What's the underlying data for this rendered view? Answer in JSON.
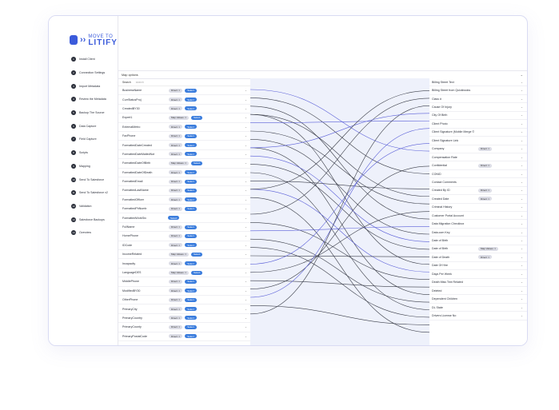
{
  "brand": {
    "line1": "MOVE TO",
    "line2": "LITIFY"
  },
  "steps": [
    {
      "num": "1",
      "label": "Install Client"
    },
    {
      "num": "2",
      "label": "Connection Settings"
    },
    {
      "num": "3",
      "label": "Import Metadata"
    },
    {
      "num": "4",
      "label": "Review the Metadata"
    },
    {
      "num": "5",
      "label": "Backup The Source"
    },
    {
      "num": "6",
      "label": "Data Capture"
    },
    {
      "num": "7",
      "label": "Field Capture"
    },
    {
      "num": "8",
      "label": "Scripts"
    },
    {
      "num": "9",
      "label": "Mapping"
    },
    {
      "num": "10",
      "label": "Send To Salesforce"
    },
    {
      "num": "11",
      "label": "Send To Salesforce v2"
    },
    {
      "num": "12",
      "label": "Validation"
    },
    {
      "num": "13",
      "label": "Salesforce Backups"
    },
    {
      "num": "14",
      "label": "Overview"
    }
  ],
  "map_options": {
    "label": "Map options",
    "caret": "⌄"
  },
  "search": {
    "label": "Search",
    "placeholder": "search"
  },
  "select_label": "Select",
  "left_fields": [
    {
      "name": "BusinessName",
      "chip": "Direct ⇒"
    },
    {
      "name": "CurrStatusProj",
      "chip": "Direct ⇒"
    },
    {
      "name": "CreatedBY30",
      "chip": "Direct ⇒"
    },
    {
      "name": "Expert1",
      "chip": "Map Values ⇒"
    },
    {
      "name": "ExternalMetro",
      "chip": "Direct ⇒"
    },
    {
      "name": "FaxPhone",
      "chip": "Direct ⇒"
    },
    {
      "name": "FormattedDateCreated",
      "chip": "Direct ⇒"
    },
    {
      "name": "FormattedDateMailedNot",
      "chip": "Direct ⇒"
    },
    {
      "name": "FormattedDateOfBirth",
      "chip": "Map Values ⇒"
    },
    {
      "name": "FormattedDateOfDeath",
      "chip": "Direct ⇒"
    },
    {
      "name": "FormattedEmail",
      "chip": "Direct ⇒"
    },
    {
      "name": "FormattedLastName",
      "chip": "Direct ⇒"
    },
    {
      "name": "FormattedOfficer",
      "chip": "Direct ⇒"
    },
    {
      "name": "FormattedPhNumb",
      "chip": "Direct ⇒"
    },
    {
      "name": "FormattedWorkSrc",
      "chip": ""
    },
    {
      "name": "FullName",
      "chip": "Direct ⇒"
    },
    {
      "name": "HomePhone",
      "chip": "Direct ⇒"
    },
    {
      "name": "IDCode",
      "chip": "Direct ⇒"
    },
    {
      "name": "IncomeRelated",
      "chip": "Map Values ⇒"
    },
    {
      "name": "Incapacity",
      "chip": "Direct ⇒"
    },
    {
      "name": "LanguageDES",
      "chip": "Map Values ⇒"
    },
    {
      "name": "MiddlePhone",
      "chip": "Direct ⇒"
    },
    {
      "name": "ModifiedBY30",
      "chip": "Direct ⇒"
    },
    {
      "name": "OtherPhone",
      "chip": "Direct ⇒"
    },
    {
      "name": "PrimaryCity",
      "chip": "Direct ⇒"
    },
    {
      "name": "PrimaryCountry",
      "chip": "Direct ⇒"
    },
    {
      "name": "PrimaryCounty",
      "chip": "Direct ⇒"
    },
    {
      "name": "PrimaryPostalCode",
      "chip": "Direct ⇒"
    }
  ],
  "right_fields": [
    {
      "name": "Billing Street Text",
      "chip": ""
    },
    {
      "name": "Billing Street from Quickbooks",
      "chip": ""
    },
    {
      "name": "Class #",
      "chip": ""
    },
    {
      "name": "Cause Of Injury",
      "chip": ""
    },
    {
      "name": "City Of Birth",
      "chip": ""
    },
    {
      "name": "Client Photo",
      "chip": ""
    },
    {
      "name": "Client Signature (Mobile Merge ©",
      "chip": ""
    },
    {
      "name": "Client Signature Link",
      "chip": ""
    },
    {
      "name": "Company",
      "chip": "Direct ⇒"
    },
    {
      "name": "Compensation Rate",
      "chip": ""
    },
    {
      "name": "Confidential",
      "chip": "Direct ⇒"
    },
    {
      "name": "CONID",
      "chip": ""
    },
    {
      "name": "Contact Comments",
      "chip": ""
    },
    {
      "name": "Created By ID",
      "chip": "Direct ⇒"
    },
    {
      "name": "Created Date",
      "chip": "Direct ⇒"
    },
    {
      "name": "Criminal History",
      "chip": ""
    },
    {
      "name": "Customer Portal Account",
      "chip": ""
    },
    {
      "name": "Data Migration Checkbox",
      "chip": ""
    },
    {
      "name": "Data.com Key",
      "chip": ""
    },
    {
      "name": "Date of Birth",
      "chip": ""
    },
    {
      "name": "Date of Birth",
      "chip": "Map Values ⇒"
    },
    {
      "name": "Date of Death",
      "chip": "Direct ⇒"
    },
    {
      "name": "Date Of Hire",
      "chip": ""
    },
    {
      "name": "Days Per Week",
      "chip": ""
    },
    {
      "name": "Death Miss Text Related",
      "chip": ""
    },
    {
      "name": "Deleted",
      "chip": ""
    },
    {
      "name": "Dependent Children",
      "chip": ""
    },
    {
      "name": "DL State",
      "chip": ""
    },
    {
      "name": "Drivers License No",
      "chip": ""
    }
  ],
  "chevron": "⌄"
}
